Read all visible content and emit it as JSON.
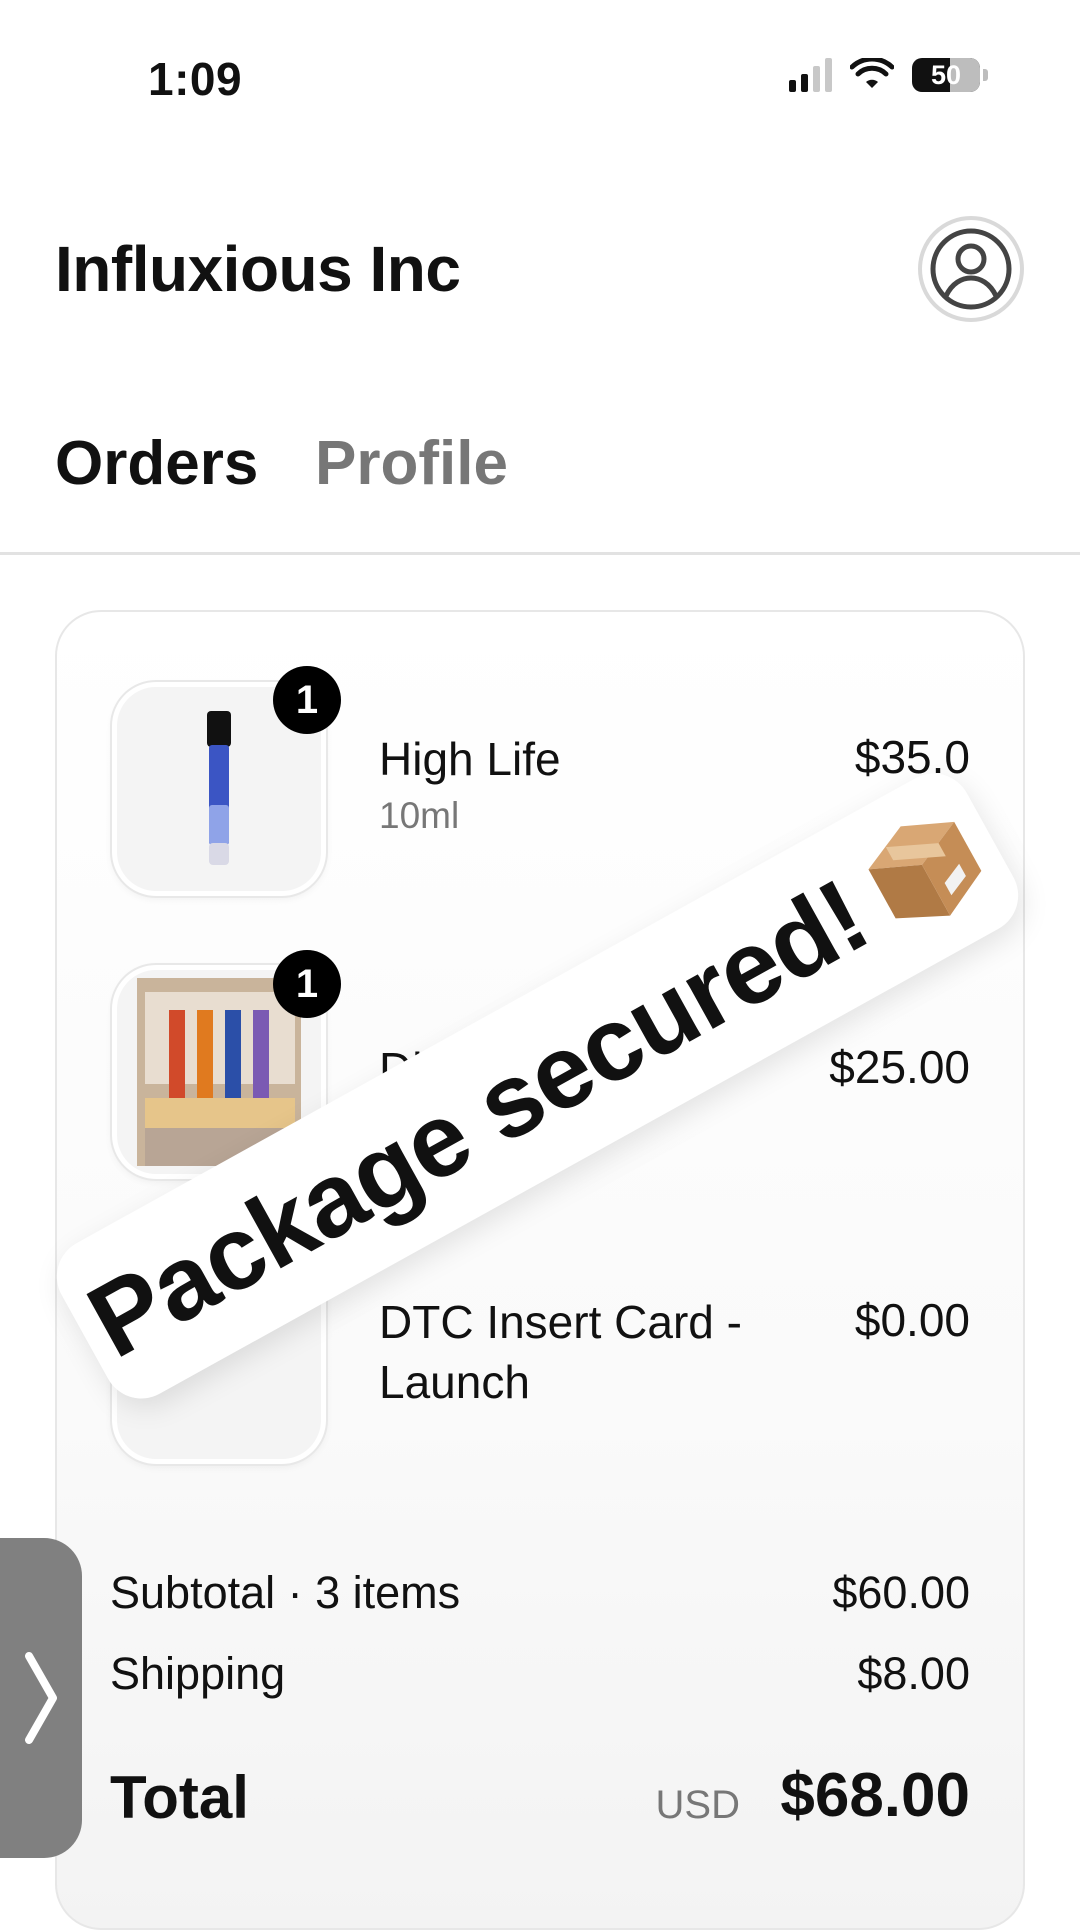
{
  "status_bar": {
    "time": "1:09",
    "battery": "50"
  },
  "header": {
    "company_name": "Influxious Inc"
  },
  "tabs": [
    {
      "label": "Orders",
      "active": true
    },
    {
      "label": "Profile",
      "active": false
    }
  ],
  "order": {
    "items": [
      {
        "name": "High Life",
        "variant": "10ml",
        "price": "$35.0",
        "quantity": "1"
      },
      {
        "name": "Di",
        "price": "$25.00",
        "quantity": "1"
      },
      {
        "name": "DTC Insert Card - Launch",
        "name_line1": "DTC Insert Card -",
        "name_line2": "Launch",
        "price": "$0.00"
      }
    ],
    "subtotal_label": "Subtotal · 3 items",
    "subtotal_value": "$60.00",
    "shipping_label": "Shipping",
    "shipping_value": "$8.00",
    "total_label": "Total",
    "currency": "USD",
    "total_value": "$68.00"
  },
  "overlay": {
    "text": "Package secured!",
    "emoji": "📦"
  },
  "colors": {
    "accent": "#000000",
    "muted_text": "#777777",
    "side_handle": "#808080"
  }
}
